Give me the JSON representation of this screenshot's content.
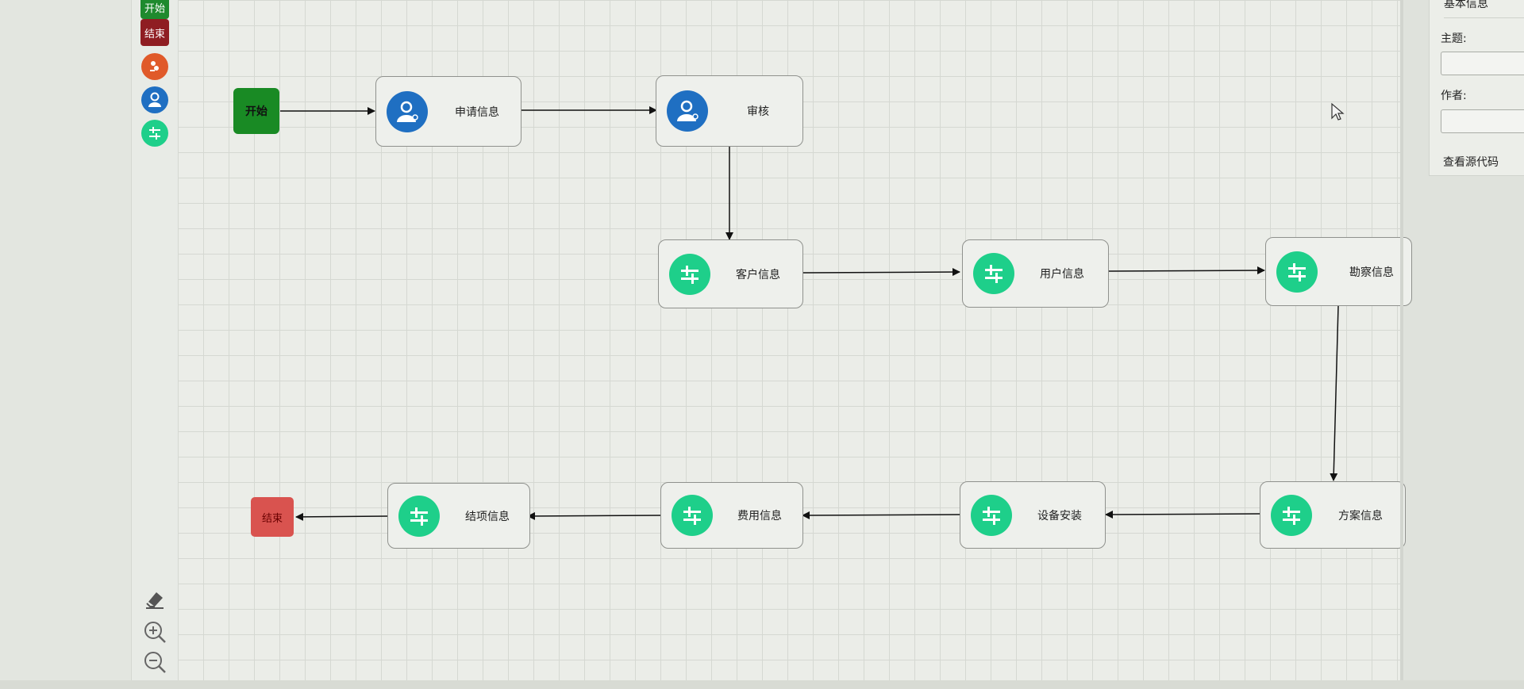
{
  "toolbar": {
    "items": [
      {
        "name": "start",
        "label": "开始"
      },
      {
        "name": "end",
        "label": "结束"
      },
      {
        "name": "task",
        "icon": "task-icon"
      },
      {
        "name": "user-task",
        "icon": "user-icon"
      },
      {
        "name": "service-task",
        "icon": "sliders-icon"
      }
    ],
    "zoom": {
      "eraser": "eraser-icon",
      "zoom_in": "zoom-in-icon",
      "zoom_out": "zoom-out-icon"
    }
  },
  "flow": {
    "start": "开始",
    "end": "结束",
    "nodes": [
      {
        "id": "apply",
        "label": "申请信息",
        "icon": "user-icon"
      },
      {
        "id": "review",
        "label": "审核",
        "icon": "user-icon"
      },
      {
        "id": "customer",
        "label": "客户信息",
        "icon": "sliders-icon"
      },
      {
        "id": "user_info",
        "label": "用户信息",
        "icon": "sliders-icon"
      },
      {
        "id": "survey",
        "label": "勘察信息",
        "icon": "sliders-icon"
      },
      {
        "id": "plan",
        "label": "方案信息",
        "icon": "sliders-icon"
      },
      {
        "id": "install",
        "label": "设备安装",
        "icon": "sliders-icon"
      },
      {
        "id": "fee",
        "label": "费用信息",
        "icon": "sliders-icon"
      },
      {
        "id": "close",
        "label": "结项信息",
        "icon": "sliders-icon"
      }
    ]
  },
  "panel": {
    "title": "基本信息",
    "subject_label": "主题:",
    "subject_value": "",
    "author_label": "作者:",
    "author_value": "",
    "view_source": "查看源代码"
  },
  "colors": {
    "start": "#198a24",
    "end": "#d9534f",
    "user_icon": "#1f6fc2",
    "setting_icon": "#1ecf8a",
    "canvas": "#ebede8"
  }
}
